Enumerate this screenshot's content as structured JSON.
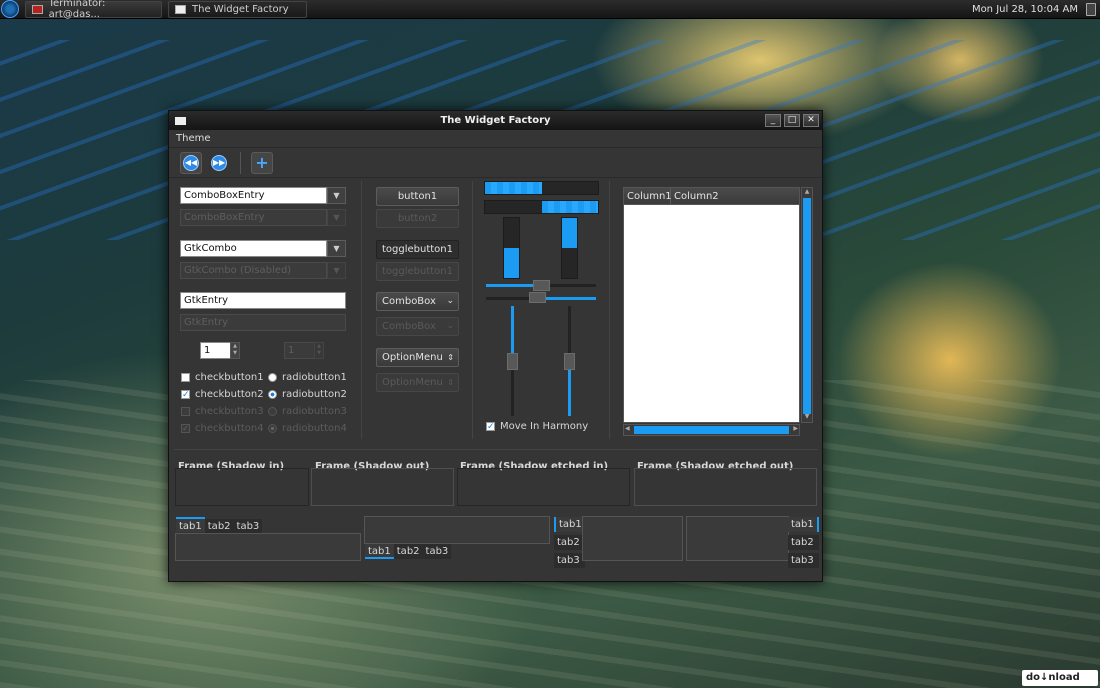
{
  "panel": {
    "tasks": [
      "Terminator: art@das...",
      "The Widget Factory"
    ],
    "clock": "Mon Jul 28, 10:04 AM"
  },
  "window": {
    "title": "The Widget Factory",
    "menu": [
      "Theme"
    ]
  },
  "col1": {
    "combo_entry": "ComboBoxEntry",
    "combo_entry_disabled": "ComboBoxEntry",
    "gtk_combo": "GtkCombo",
    "gtk_combo_disabled": "GtkCombo (Disabled)",
    "gtk_entry": "GtkEntry",
    "gtk_entry_disabled": "GtkEntry",
    "spin_value": "1",
    "spin_disabled_value": "1",
    "checks": [
      "checkbutton1",
      "checkbutton2",
      "checkbutton3",
      "checkbutton4"
    ],
    "radios": [
      "radiobutton1",
      "radiobutton2",
      "radiobutton3",
      "radiobutton4"
    ]
  },
  "col2": {
    "button1": "button1",
    "button2": "button2",
    "toggle1": "togglebutton1",
    "toggle2": "togglebutton1",
    "combobox": "ComboBox",
    "combobox_disabled": "ComboBox",
    "optionmenu": "OptionMenu",
    "optionmenu_disabled": "OptionMenu"
  },
  "col3": {
    "hprogress1": 0.5,
    "hprogress2": 0.5,
    "vprogress1": 0.5,
    "vprogress2": 0.5,
    "hscale": 0.5,
    "vscale": 0.5,
    "move_in_harmony": "Move In Harmony"
  },
  "tree": {
    "columns": [
      "Column1",
      "Column2"
    ]
  },
  "frames": [
    "Frame (Shadow in)",
    "Frame (Shadow out)",
    "Frame (Shadow etched in)",
    "Frame (Shadow etched out)"
  ],
  "tabs": [
    "tab1",
    "tab2",
    "tab3"
  ],
  "watermark": "do↓nload",
  "colors": {
    "accent": "#1b9cf2",
    "window_bg": "#353535"
  }
}
